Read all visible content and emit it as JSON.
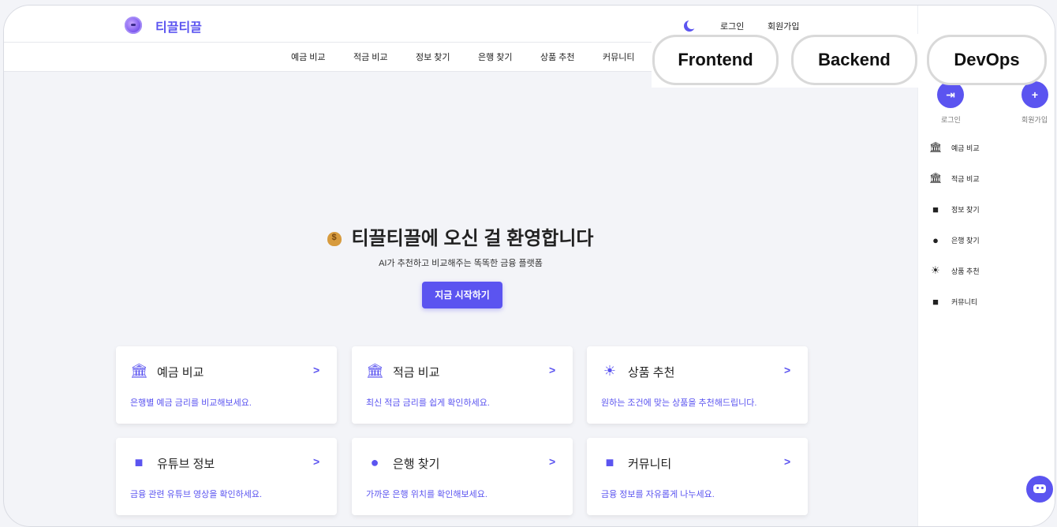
{
  "header": {
    "brand": "티끌티끌",
    "login": "로그인",
    "signup": "회원가입"
  },
  "nav": [
    "예금 비교",
    "적금 비교",
    "정보 찾기",
    "은행 찾기",
    "상품 추천",
    "커뮤니티"
  ],
  "tech_tags": [
    "Frontend",
    "Backend",
    "DevOps"
  ],
  "sidebar": {
    "login_label": "로그인",
    "signup_label": "회원가입",
    "items": [
      {
        "icon": "bank-icon",
        "label": "예금 비교"
      },
      {
        "icon": "savings-icon",
        "label": "적금 비교"
      },
      {
        "icon": "video-icon",
        "label": "정보 찾기"
      },
      {
        "icon": "location-icon",
        "label": "은행 찾기"
      },
      {
        "icon": "lightbulb-icon",
        "label": "상품 추천"
      },
      {
        "icon": "chat-icon",
        "label": "커뮤니티"
      }
    ]
  },
  "hero": {
    "title": "티끌티끌에 오신 걸 환영합니다",
    "subtitle": "AI가 추천하고 비교해주는 똑똑한 금융 플랫폼",
    "cta": "지금 시작하기"
  },
  "cards": [
    {
      "icon": "bank-icon",
      "title": "예금 비교",
      "desc": "은행별 예금 금리를 비교해보세요."
    },
    {
      "icon": "savings-icon",
      "title": "적금 비교",
      "desc": "최신 적금 금리를 쉽게 확인하세요."
    },
    {
      "icon": "lightbulb-icon",
      "title": "상품 추천",
      "desc": "원하는 조건에 맞는 상품을 추천해드립니다."
    },
    {
      "icon": "video-icon",
      "title": "유튜브 정보",
      "desc": "금융 관련 유튜브 영상을 확인하세요."
    },
    {
      "icon": "location-icon",
      "title": "은행 찾기",
      "desc": "가까운 은행 위치를 확인해보세요."
    },
    {
      "icon": "chat-icon",
      "title": "커뮤니티",
      "desc": "금융 정보를 자유롭게 나누세요."
    }
  ],
  "chevron": ">",
  "colors": {
    "accent": "#5b54f0",
    "background": "#f3f4f8"
  }
}
